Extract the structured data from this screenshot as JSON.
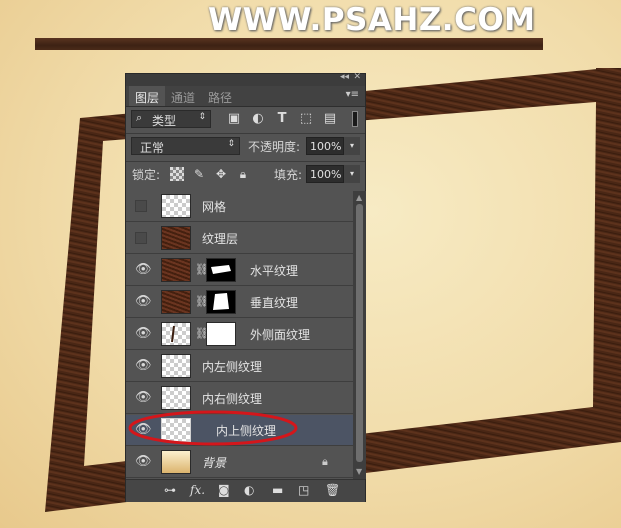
{
  "watermark": "WWW.PSAHZ.COM",
  "panel": {
    "tabs": [
      {
        "label": "图层"
      },
      {
        "label": "通道"
      },
      {
        "label": "路径"
      }
    ],
    "filter": {
      "label": "类型"
    },
    "blend_mode": "正常",
    "opacity_label": "不透明度:",
    "opacity_value": "100%",
    "lock_label": "锁定:",
    "fill_label": "填充:",
    "fill_value": "100%",
    "layers": [
      {
        "name": "网格",
        "visible": false
      },
      {
        "name": "纹理层",
        "visible": false
      },
      {
        "name": "水平纹理",
        "visible": true
      },
      {
        "name": "垂直纹理",
        "visible": true
      },
      {
        "name": "外侧面纹理",
        "visible": true
      },
      {
        "name": "内左侧纹理",
        "visible": true
      },
      {
        "name": "内右侧纹理",
        "visible": true
      },
      {
        "name": "内上侧纹理",
        "visible": true,
        "selected": true
      },
      {
        "name": "背景",
        "visible": true,
        "locked": true
      }
    ],
    "footer_icons": [
      "link-layers-icon",
      "fx-icon",
      "add-mask-icon",
      "adjustment-layer-icon",
      "new-group-icon",
      "new-layer-icon",
      "delete-layer-icon"
    ]
  },
  "colors": {
    "panel_bg": "#535353",
    "selection": "#4c5464",
    "annotation_red": "#d4161b",
    "wood": "#4a2a18"
  }
}
